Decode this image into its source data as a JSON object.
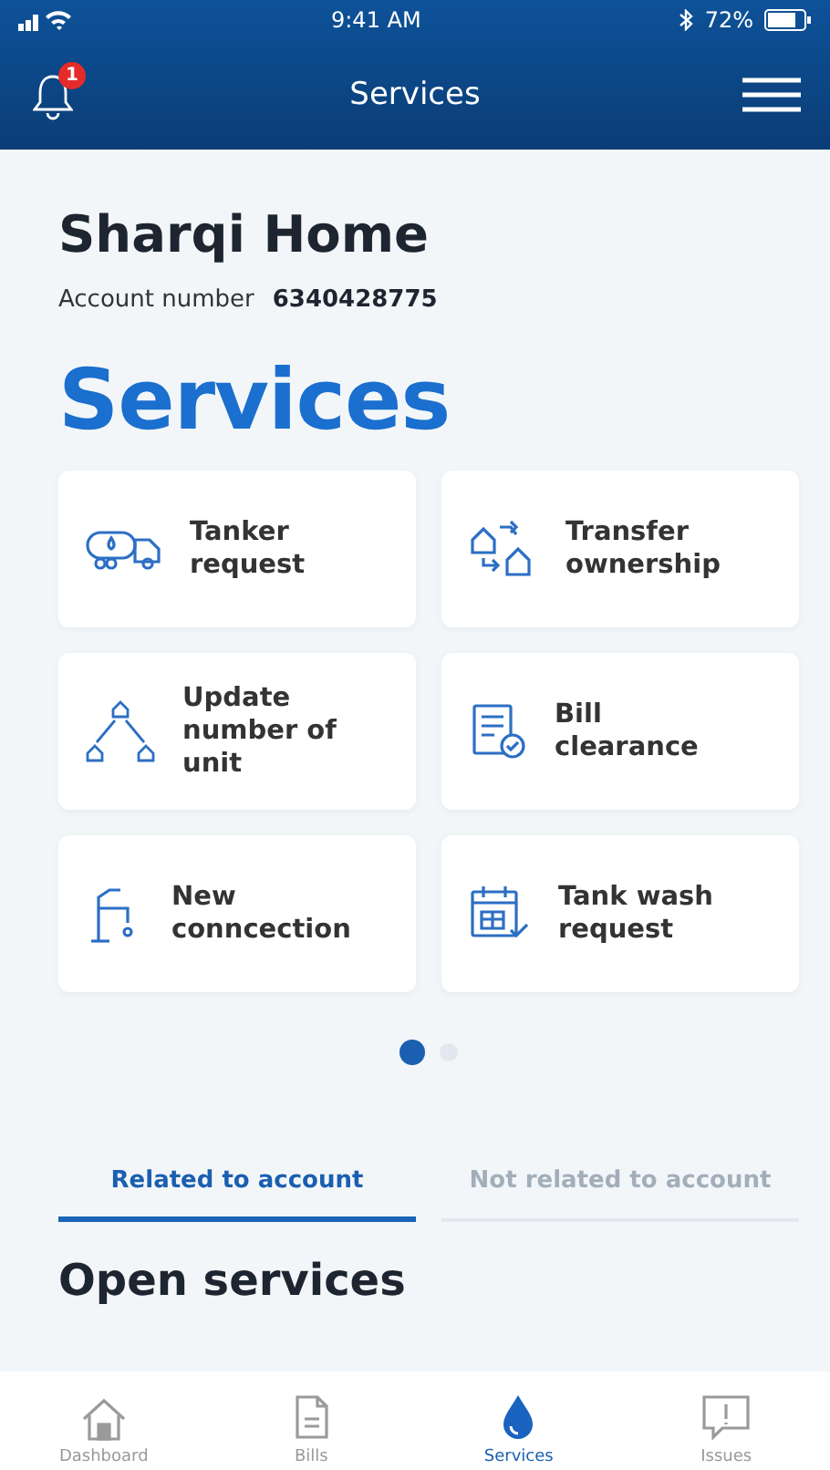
{
  "status_bar": {
    "time": "9:41 AM",
    "battery": "72%"
  },
  "header": {
    "title": "Services",
    "notification_count": "1"
  },
  "account": {
    "name": "Sharqi Home",
    "number_label": "Account number",
    "number": "6340428775"
  },
  "heading": "Services",
  "services": [
    {
      "label": "Tanker request"
    },
    {
      "label": "Transfer ownership"
    },
    {
      "label": "Update number of unit"
    },
    {
      "label": "Bill clearance"
    },
    {
      "label": "New conncection"
    },
    {
      "label": "Tank wash request"
    }
  ],
  "pager": [
    {
      "selected": true
    },
    {
      "selected": false
    }
  ],
  "tabs": [
    {
      "label": "Related to account",
      "selected": true
    },
    {
      "label": "Not related to account",
      "selected": false
    }
  ],
  "section_title": "Open services",
  "nav": [
    {
      "label": "Dashboard",
      "selected": false
    },
    {
      "label": "Bills",
      "selected": false
    },
    {
      "label": "Services",
      "selected": true
    },
    {
      "label": "Issues",
      "selected": false
    }
  ]
}
